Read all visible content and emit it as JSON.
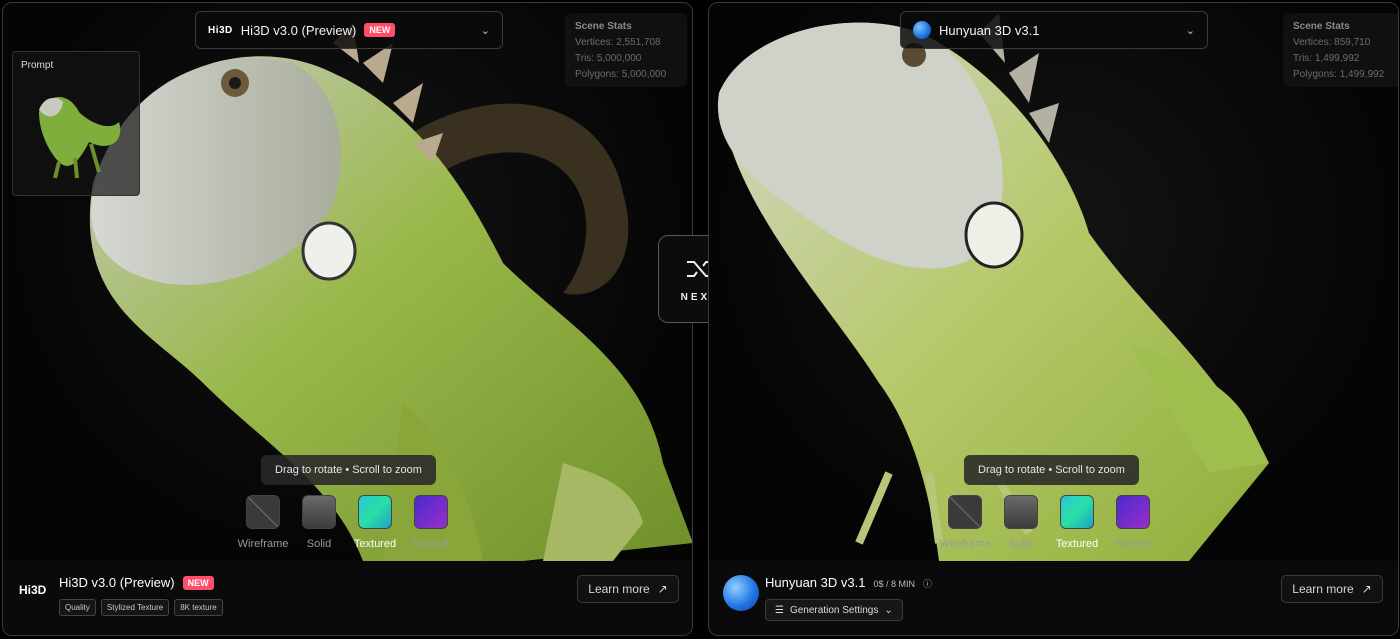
{
  "left": {
    "model_select": {
      "logo": "Hi3D",
      "name": "Hi3D v3.0 (Preview)",
      "badge": "NEW"
    },
    "stats": {
      "title": "Scene Stats",
      "vertices": "Vertices: 2,551,708",
      "tris": "Tris: 5,000,000",
      "polygons": "Polygons: 5,000,000"
    },
    "prompt_label": "Prompt",
    "hint": "Drag to rotate • Scroll to zoom",
    "modes": [
      "Wireframe",
      "Solid",
      "Textured",
      "Normal"
    ],
    "active_mode": "Textured",
    "footer": {
      "logo": "Hi3D",
      "title": "Hi3D v3.0 (Preview)",
      "badge": "NEW",
      "tags": [
        "Quality",
        "Stylized Texture",
        "8K texture"
      ],
      "learn_more": "Learn more"
    }
  },
  "right": {
    "model_select": {
      "name": "Hunyuan 3D v3.1"
    },
    "stats": {
      "title": "Scene Stats",
      "vertices": "Vertices: 859,710",
      "tris": "Tris: 1,499,992",
      "polygons": "Polygons: 1,499,992"
    },
    "hint": "Drag to rotate • Scroll to zoom",
    "modes": [
      "Wireframe",
      "Solid",
      "Textured",
      "Normal"
    ],
    "active_mode": "Textured",
    "footer": {
      "title": "Hunyuan 3D v3.1",
      "cost": "0$ / 8 MIN",
      "gen_settings": "Generation Settings",
      "learn_more": "Learn more"
    }
  },
  "next_label": "NEXT",
  "colors": {
    "accent_new": "#ff4d6a",
    "iguana_green": "#9cc23c",
    "iguana_gray": "#cfd3c8"
  }
}
